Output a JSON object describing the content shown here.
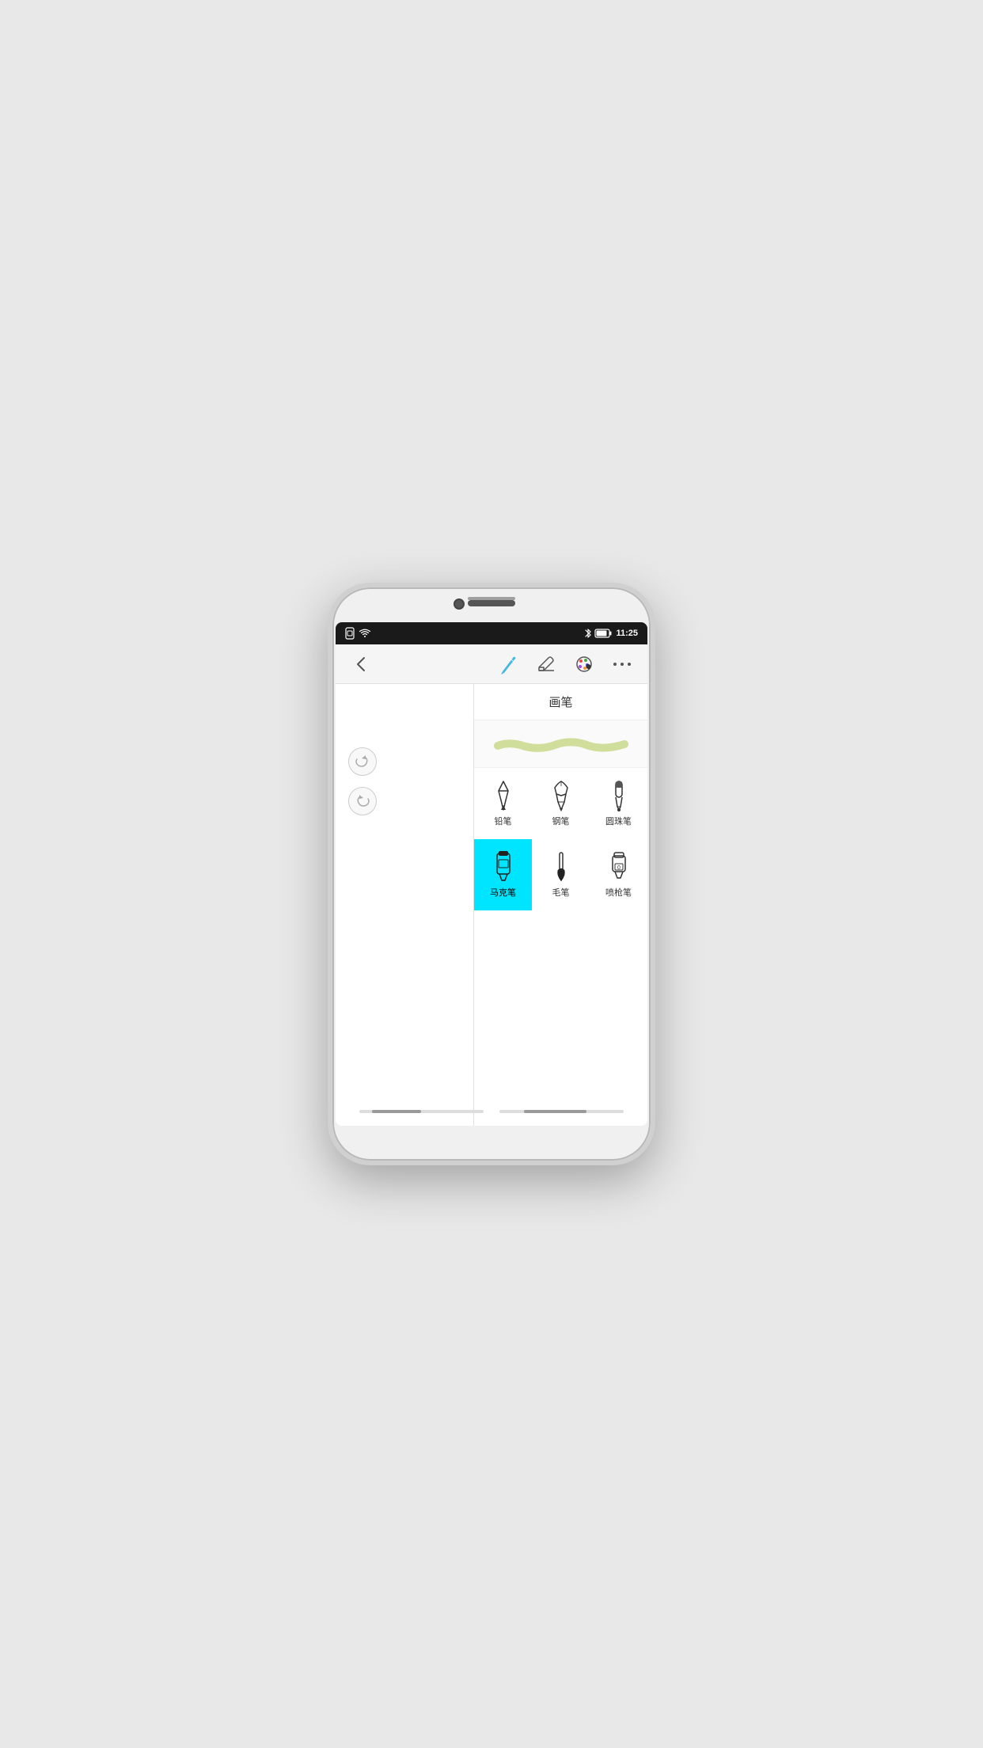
{
  "statusBar": {
    "time": "11:25",
    "bluetooth": "✦",
    "battery": "🔋"
  },
  "toolbar": {
    "backLabel": "‹",
    "title": "",
    "moreLabel": "•••"
  },
  "panel": {
    "title": "画笔",
    "tools": [
      {
        "id": "pencil",
        "label": "铅笔",
        "active": false
      },
      {
        "id": "pen",
        "label": "钢笔",
        "active": false
      },
      {
        "id": "ballpen",
        "label": "圆珠笔",
        "active": false
      },
      {
        "id": "marker",
        "label": "马克笔",
        "active": true
      },
      {
        "id": "brush",
        "label": "毛笔",
        "active": false
      },
      {
        "id": "spray",
        "label": "喷枪笔",
        "active": false
      }
    ]
  },
  "canvas": {
    "redoTitle": "redo",
    "undoTitle": "undo"
  },
  "colors": {
    "accent": "#00e5ff",
    "brushStroke": "#c8d88a",
    "toolbarBg": "#f5f5f5",
    "penIconColor": "#45b8e0"
  }
}
